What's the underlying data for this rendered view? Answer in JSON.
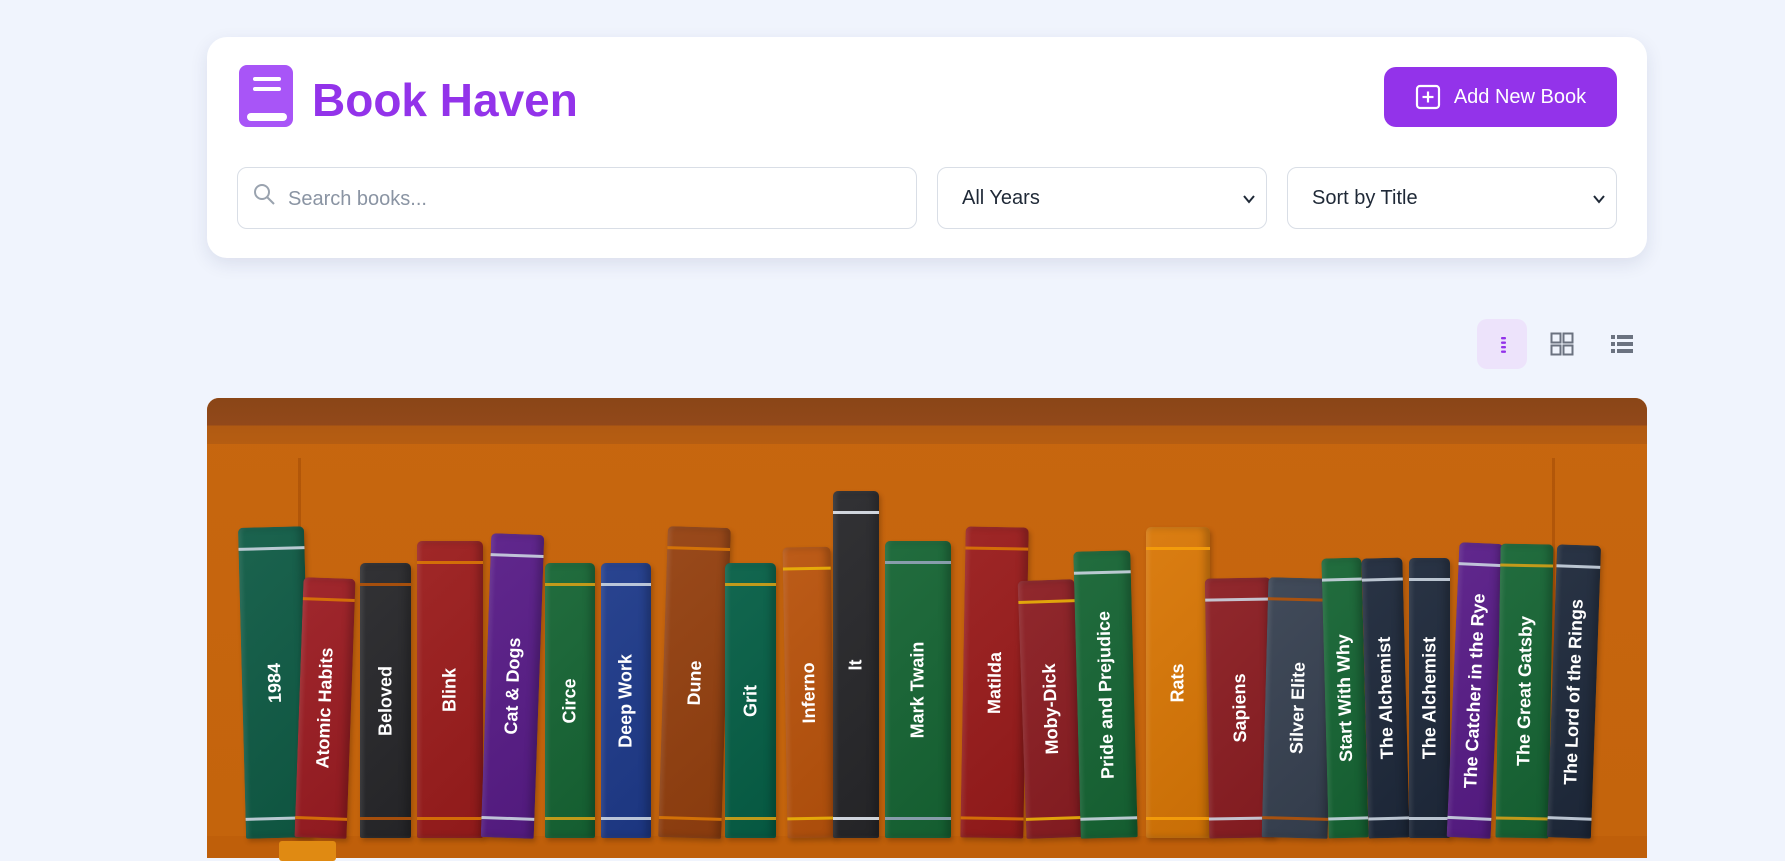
{
  "header": {
    "title": "Book Haven",
    "add_button_label": "Add New Book"
  },
  "filters": {
    "search_placeholder": "Search books...",
    "year_select_value": "All Years",
    "sort_select_value": "Sort by Title"
  },
  "view_modes": [
    {
      "name": "shelf",
      "icon": "shelf-view-icon",
      "active": true
    },
    {
      "name": "grid",
      "icon": "grid-view-icon",
      "active": false
    },
    {
      "name": "list",
      "icon": "list-view-icon",
      "active": false
    }
  ],
  "colors": {
    "accent": "#9333ea",
    "background": "#f0f4fd",
    "shelf_wood": "#c4640c"
  },
  "books": [
    {
      "title": "1984",
      "color": "#0f5b45",
      "band": "#cbd5e1"
    },
    {
      "title": "Atomic Habits",
      "color": "#9b1c22",
      "band": "#d97706"
    },
    {
      "title": "Beloved",
      "color": "#27272a",
      "band": "#b45309"
    },
    {
      "title": "Blink",
      "color": "#9b1c1c",
      "band": "#d97706"
    },
    {
      "title": "Cat & Dogs",
      "color": "#581c87",
      "band": "#cbd5e1"
    },
    {
      "title": "Circe",
      "color": "#166534",
      "band": "#d4a017"
    },
    {
      "title": "Deep Work",
      "color": "#1e3a8a",
      "band": "#cbd5e1"
    },
    {
      "title": "Dune",
      "color": "#94400f",
      "band": "#d97706"
    },
    {
      "title": "Grit",
      "color": "#065f46",
      "band": "#d4a017"
    },
    {
      "title": "Inferno",
      "color": "#b9530c",
      "band": "#eab308"
    },
    {
      "title": "It",
      "color": "#27272a",
      "band": "#e2e8f0"
    },
    {
      "title": "Mark Twain",
      "color": "#166534",
      "band": "#94a3b8"
    },
    {
      "title": "Matilda",
      "color": "#991b1b",
      "band": "#d97706"
    },
    {
      "title": "Moby-Dick",
      "color": "#8b1d22",
      "band": "#eab308"
    },
    {
      "title": "Pride and Prejudice",
      "color": "#166534",
      "band": "#cbd5e1"
    },
    {
      "title": "Rats",
      "color": "#d97706",
      "band": "#f59e0b"
    },
    {
      "title": "Sapiens",
      "color": "#8b1d22",
      "band": "#cbd5e1"
    },
    {
      "title": "Silver Elite",
      "color": "#374151",
      "band": "#b45309"
    },
    {
      "title": "Start With Why",
      "color": "#166534",
      "band": "#cbd5e1"
    },
    {
      "title": "The Alchemist",
      "color": "#1e293b",
      "band": "#cbd5e1"
    },
    {
      "title": "The Alchemist",
      "color": "#1e293b",
      "band": "#cbd5e1"
    },
    {
      "title": "The Catcher in the Rye",
      "color": "#581c87",
      "band": "#cbd5e1"
    },
    {
      "title": "The Great Gatsby",
      "color": "#166534",
      "band": "#d4a017"
    },
    {
      "title": "The Lord of the Rings",
      "color": "#1e293b",
      "band": "#cbd5e1"
    }
  ]
}
